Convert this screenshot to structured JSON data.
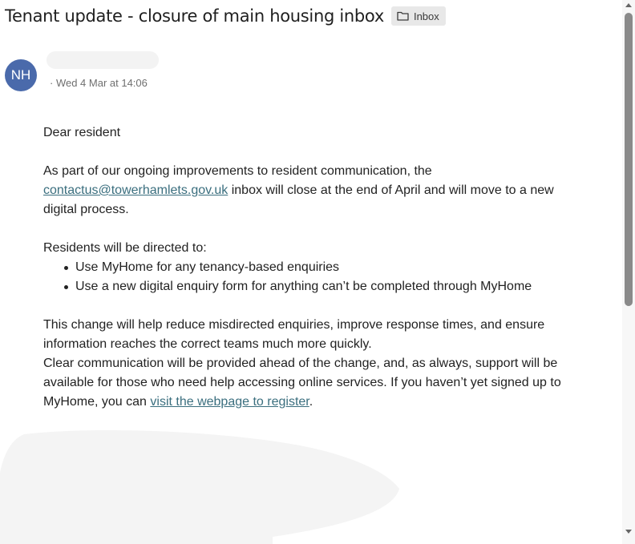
{
  "email": {
    "subject": "Tenant update - closure of main housing inbox",
    "label": "Inbox",
    "avatar_initials": "NH",
    "date": "· Wed 4 Mar at 14:06"
  },
  "body": {
    "greeting": "Dear resident",
    "p1_before": "As part of our ongoing improvements to resident communication, the",
    "p1_link": "contactus@towerhamlets.gov.uk",
    "p1_after": " inbox will close at the end of April and will move to a new digital process.",
    "list_intro": "Residents will be directed to:",
    "list": [
      "Use MyHome for any tenancy-based enquiries",
      "Use a new digital enquiry form for anything can’t be completed through MyHome"
    ],
    "p2": "This change will help reduce misdirected enquiries, improve response times, and ensure information reaches the correct teams much more quickly.",
    "p3_before": "Clear communication will be provided ahead of the change, and, as always, support will be available for those who need help accessing online services. If you haven’t yet signed up to MyHome, you can ",
    "p3_link": "visit the webpage to register",
    "p3_after": "."
  },
  "icons": {
    "label": "folder-icon",
    "scroll_up": "scroll-up-arrow-icon",
    "scroll_down": "scroll-down-arrow-icon"
  },
  "colors": {
    "avatar_bg": "#4a6aab",
    "link": "#3a6e7e",
    "chip_bg": "#e8e8e8"
  }
}
